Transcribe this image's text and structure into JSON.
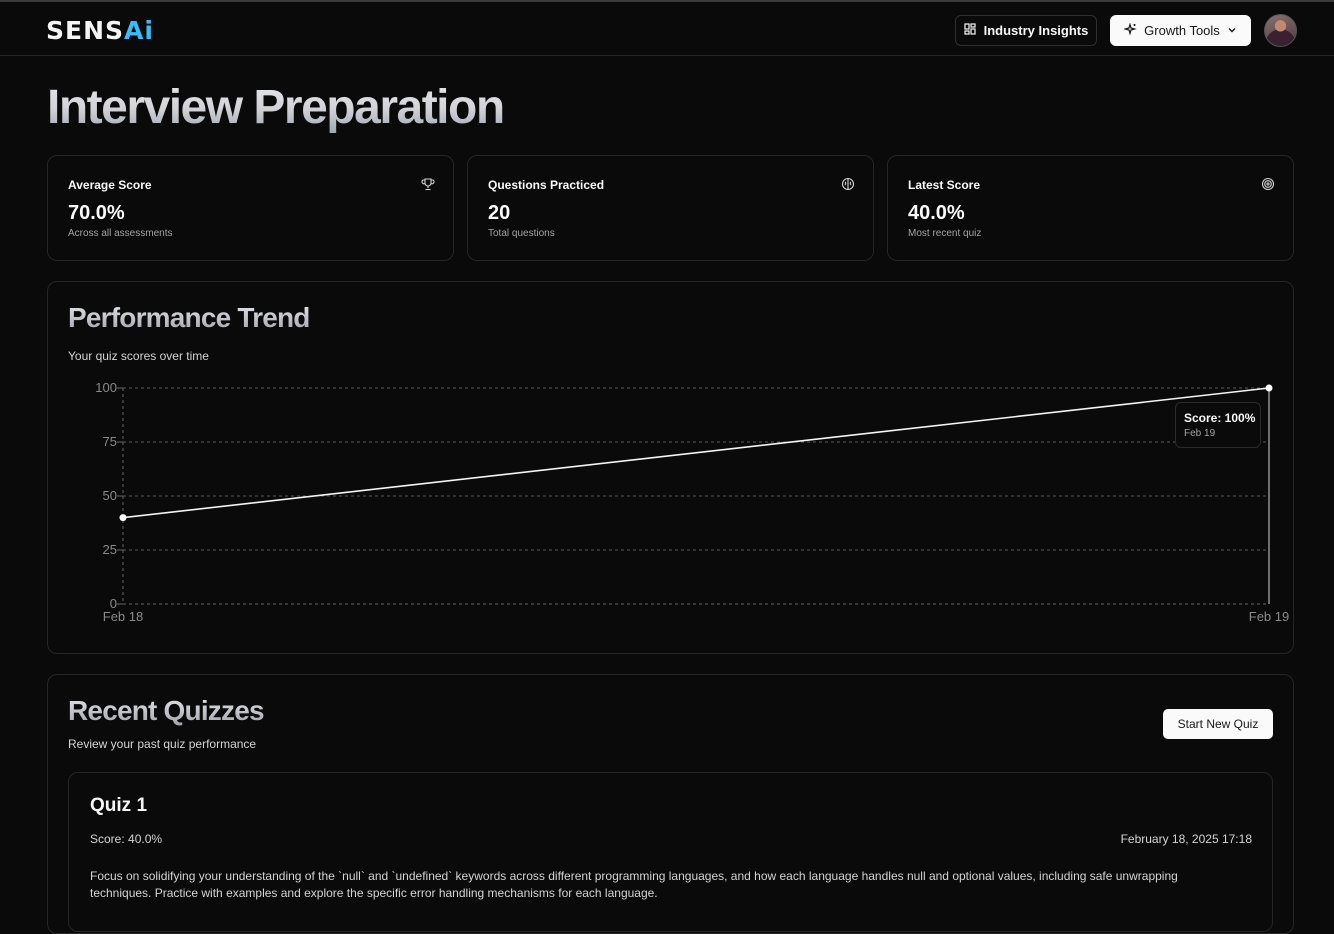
{
  "nav": {
    "logo_main": "SENS",
    "logo_accent": "Ai",
    "insights_label": "Industry Insights",
    "growth_label": "Growth Tools"
  },
  "page_title": "Interview Preparation",
  "stats": [
    {
      "label": "Average Score",
      "value": "70.0%",
      "sub": "Across all assessments",
      "icon": "trophy-icon"
    },
    {
      "label": "Questions Practiced",
      "value": "20",
      "sub": "Total questions",
      "icon": "brain-icon"
    },
    {
      "label": "Latest Score",
      "value": "40.0%",
      "sub": "Most recent quiz",
      "icon": "target-icon"
    }
  ],
  "trend": {
    "title": "Performance Trend",
    "subtitle": "Your quiz scores over time",
    "tooltip_score": "Score: 100%",
    "tooltip_date": "Feb 19"
  },
  "chart_data": {
    "type": "line",
    "categories": [
      "Feb 18",
      "Feb 19"
    ],
    "series": [
      {
        "values": [
          40,
          100
        ]
      }
    ],
    "ylim": [
      0,
      100
    ],
    "yticks": [
      0,
      25,
      50,
      75,
      100
    ],
    "grid": true
  },
  "recent": {
    "title": "Recent Quizzes",
    "subtitle": "Review your past quiz performance",
    "start_label": "Start New Quiz",
    "quizzes": [
      {
        "title": "Quiz 1",
        "score": "Score: 40.0%",
        "date": "February 18, 2025 17:18",
        "tip": "Focus on solidifying your understanding of the `null` and `undefined` keywords across different programming languages, and how each language handles null and optional values, including safe unwrapping techniques. Practice with examples and explore the specific error handling mechanisms for each language."
      }
    ]
  }
}
